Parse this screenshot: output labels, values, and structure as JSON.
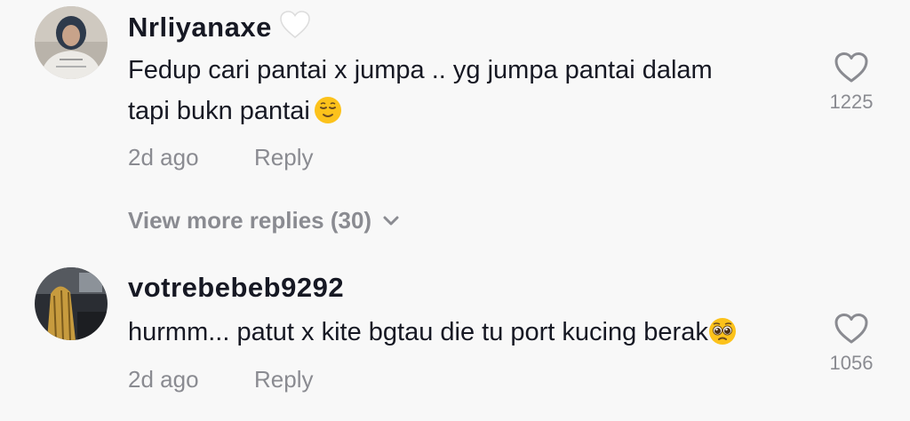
{
  "comments": [
    {
      "username": "Nrliyanaxe",
      "badge_icon": "white-heart-icon",
      "text_lines": [
        "Fedup cari pantai x jumpa .. yg jumpa pantai dalam",
        "tapi bukn pantai"
      ],
      "emoji": "relieved-face-icon",
      "time": "2d ago",
      "reply_label": "Reply",
      "like_count": "1225",
      "view_more": "View more replies (30)"
    },
    {
      "username": "votrebebeb9292",
      "text": "hurmm... patut x kite bgtau die tu port kucing berak",
      "emoji": "pleading-face-icon",
      "time": "2d ago",
      "reply_label": "Reply",
      "like_count": "1056"
    }
  ],
  "colors": {
    "background": "#f8f8f8",
    "username": "#161823",
    "secondary": "#8a8b91"
  }
}
